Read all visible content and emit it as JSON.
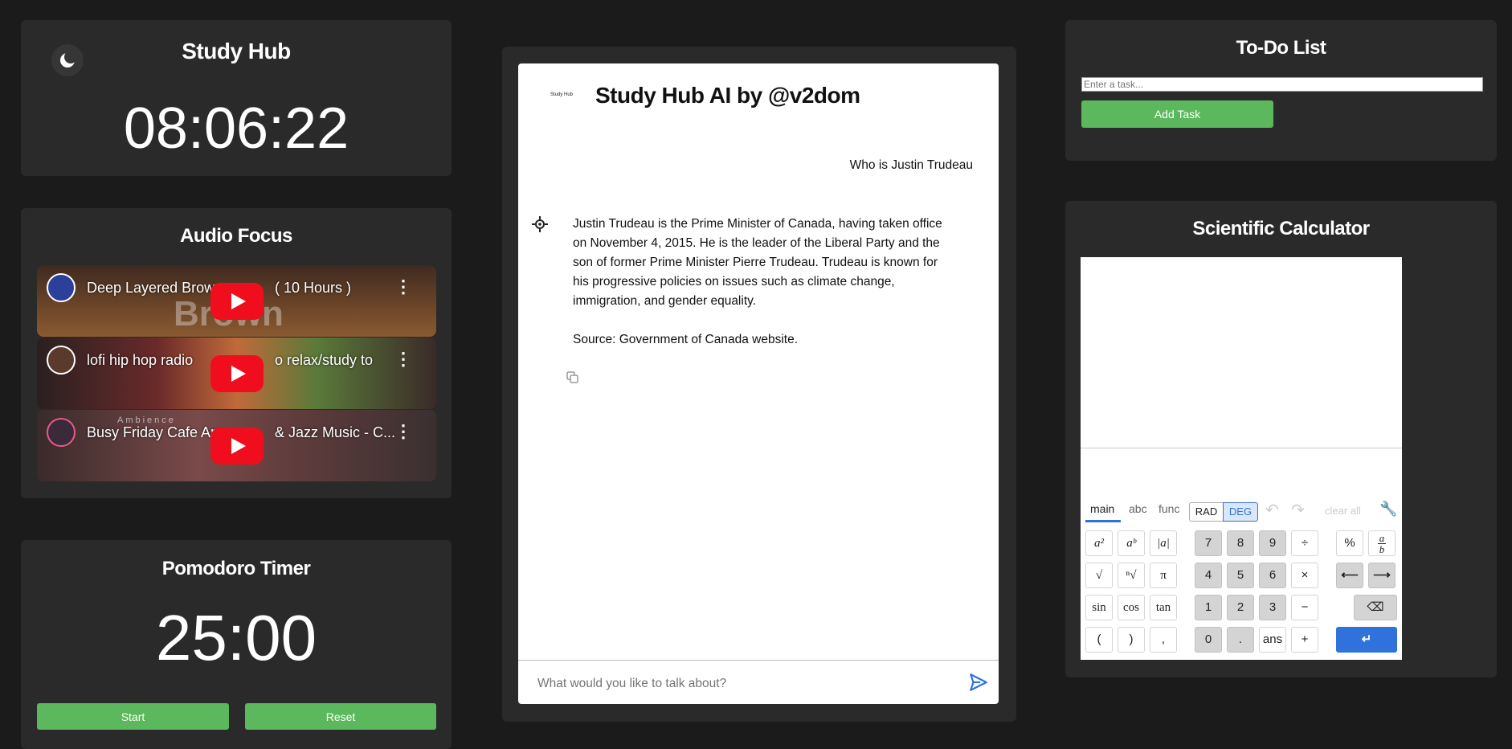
{
  "clock": {
    "title": "Study Hub",
    "time": "08:06:22",
    "theme_icon": "moon-icon"
  },
  "audio": {
    "title": "Audio Focus",
    "videos": [
      {
        "title": "Deep Layered Brow",
        "title_end": "( 10 Hours )",
        "overlay": "Brown"
      },
      {
        "title": "lofi hip hop radio",
        "title_end": "o relax/study to"
      },
      {
        "title": "Busy Friday Cafe Am",
        "title_end": "& Jazz Music - C...",
        "overlay": "Ambience"
      }
    ]
  },
  "pomodoro": {
    "title": "Pomodoro Timer",
    "time": "25:00",
    "start": "Start",
    "reset": "Reset"
  },
  "chat": {
    "logo_text": "Study Hub",
    "title": "Study Hub AI by @v2dom",
    "user_msg": "Who is Justin Trudeau",
    "bot_para1": "Justin Trudeau is the Prime Minister of Canada, having taken office on November 4, 2015. He is the leader of the Liberal Party and the son of former Prime Minister Pierre Trudeau. Trudeau is known for his progressive policies on issues such as climate change, immigration, and gender equality.",
    "bot_para2": "Source: Government of Canada website.",
    "input_placeholder": "What would you like to talk about?"
  },
  "todo": {
    "title": "To-Do List",
    "input_placeholder": "Enter a task...",
    "add_label": "Add Task"
  },
  "calculator": {
    "title": "Scientific Calculator",
    "tabs": [
      "main",
      "abc",
      "func"
    ],
    "angle": [
      "RAD",
      "DEG"
    ],
    "clear_all": "clear all",
    "keys": {
      "a2": "a²",
      "ab": "aᵇ",
      "abs": "|a|",
      "sqrt": "√",
      "nroot": "ⁿ√",
      "pi": "π",
      "sin": "sin",
      "cos": "cos",
      "tan": "tan",
      "lparen": "(",
      "rparen": ")",
      "comma": ",",
      "d7": "7",
      "d8": "8",
      "d9": "9",
      "div": "÷",
      "d4": "4",
      "d5": "5",
      "d6": "6",
      "mul": "×",
      "d1": "1",
      "d2": "2",
      "d3": "3",
      "minus": "−",
      "d0": "0",
      "dot": ".",
      "ans": "ans",
      "plus": "+",
      "percent": "%",
      "frac_top": "a",
      "frac_bottom": "b"
    }
  }
}
